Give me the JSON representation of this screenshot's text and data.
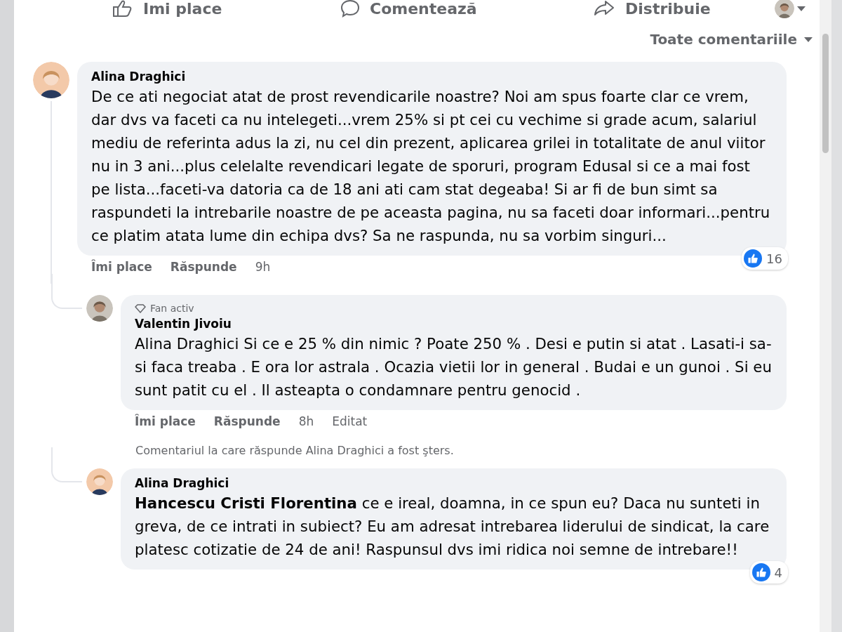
{
  "top_actions": [
    {
      "kind": "like",
      "label": "Imi place"
    },
    {
      "kind": "comment",
      "label": "Comentează"
    },
    {
      "kind": "share",
      "label": "Distribuie"
    }
  ],
  "sort": {
    "label": "Toate comentariile"
  },
  "comments": [
    {
      "author": "Alina Draghici",
      "text": "De ce ati negociat atat de prost revendicarile noastre? Noi am spus foarte clar ce vrem, dar dvs va faceti ca nu intelegeti...vrem 25% si pt cei cu vechime si grade acum, salariul mediu de referinta adus la zi, nu cel din prezent, aplicarea grilei in totalitate de anul viitor nu in 3 ani...plus celelalte revendicari legate de sporuri, program Edusal si ce a mai fost pe lista...faceti-va datoria ca de 18 ani ati cam stat degeaba! Si ar fi de bun simt sa raspundeti la intrebarile noastre de pe aceasta pagina, nu sa faceti doar informari...pentru ce platim atata lume din echipa dvs? Sa ne raspunda, nu sa vorbim singuri...",
      "actions": [
        "Îmi place",
        "Răspunde"
      ],
      "time": "9h",
      "reactions": "16",
      "replies": [
        {
          "kind": "comment",
          "badge": "Fan activ",
          "author": "Valentin Jivoiu",
          "text": "Alina Draghici Si ce e 25 % din nimic ? Poate 250 % . Desi e putin si atat . Lasati-i sa-si faca treaba . E ora lor astrala . Ocazia vietii lor in general . Budai e un gunoi . Si eu sunt patit cu el . Il asteapta o condamnare pentru genocid .",
          "actions": [
            "Îmi place",
            "Răspunde"
          ],
          "time": "8h",
          "edited_label": "Editat"
        },
        {
          "kind": "notice",
          "text": "Comentariul la care răspunde Alina Draghici a fost şters."
        },
        {
          "kind": "comment",
          "author": "Alina Draghici",
          "text": "**Hancescu Cristi Florentina** ce e ireal, doamna, in ce spun eu? Daca nu sunteti in greva, de ce intrati in subiect? Eu am adresat intrebarea liderului de sindicat, la care platesc cotizatie de 24 de ani! Raspunsul dvs imi ridica noi semne de intrebare!!",
          "reactions": "4"
        }
      ]
    }
  ]
}
